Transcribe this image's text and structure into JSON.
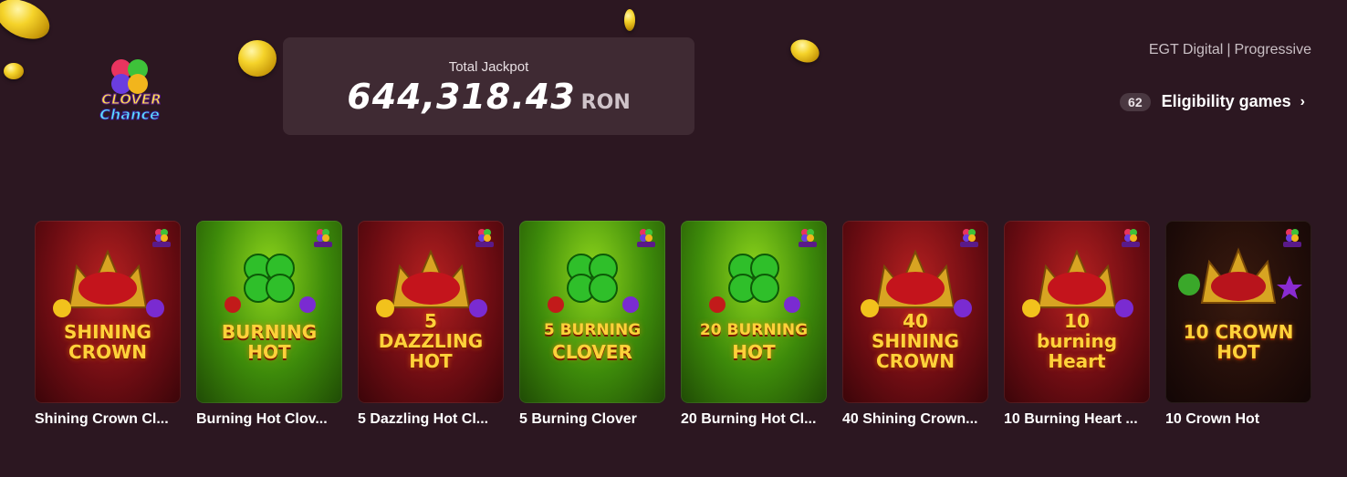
{
  "jackpot": {
    "label": "Total Jackpot",
    "amount": "644,318.43",
    "currency": "RON"
  },
  "provider": {
    "name": "EGT Digital",
    "separator": "|",
    "type": "Progressive"
  },
  "eligibility": {
    "count": "62",
    "label": "Eligibility games",
    "chevron": "›"
  },
  "logo": {
    "line1": "CLOVER",
    "line2": "Chance"
  },
  "games": [
    {
      "name": "Shining Crown Cl...",
      "art_text": [
        "SHINING",
        "CROWN"
      ],
      "theme": "red"
    },
    {
      "name": "Burning Hot Clov...",
      "art_text": [
        "BURNING",
        "HOT"
      ],
      "theme": "green"
    },
    {
      "name": "5 Dazzling Hot Cl...",
      "art_text": [
        "5",
        "DAZZLING",
        "HOT"
      ],
      "theme": "red"
    },
    {
      "name": "5 Burning Clover",
      "art_text": [
        "5 BURNING",
        "CLOVER"
      ],
      "theme": "green"
    },
    {
      "name": "20 Burning Hot Cl...",
      "art_text": [
        "20 BURNING",
        "HOT"
      ],
      "theme": "green"
    },
    {
      "name": "40 Shining Crown...",
      "art_text": [
        "40",
        "SHINING",
        "CROWN"
      ],
      "theme": "red"
    },
    {
      "name": "10 Burning Heart ...",
      "art_text": [
        "10",
        "burning",
        "Heart"
      ],
      "theme": "red"
    },
    {
      "name": "10 Crown Hot",
      "art_text": [
        "10 CROWN",
        "HOT"
      ],
      "theme": "deep"
    }
  ],
  "colors": {
    "background": "#2c1721",
    "panel": "#3f2a33",
    "gold": "#ffd23a"
  }
}
